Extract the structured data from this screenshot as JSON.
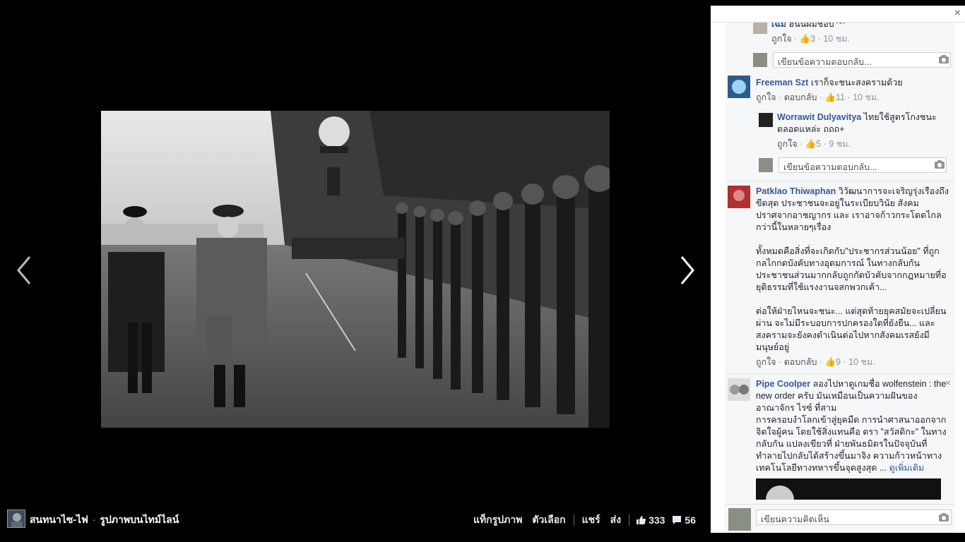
{
  "viewer": {
    "prev_label": "previous-photo",
    "next_label": "next-photo"
  },
  "bottom_bar": {
    "owner": "สนทนาไซ-ไฟ",
    "separator": "·",
    "album": "รูปภาพบนไทม์ไลน์",
    "tag_photo": "แท็กรูปภาพ",
    "options": "ตัวเลือก",
    "share": "แชร์",
    "send": "ส่ง",
    "likes": "333",
    "comments": "56"
  },
  "panel": {
    "close": "×",
    "comments": [
      {
        "type": "reply",
        "name": "เฉิม",
        "text": " ฮันนีผมชอบ ^^",
        "meta_like": "ถูกใจ",
        "meta_count": "3",
        "meta_time": "10 ชม."
      },
      {
        "type": "replybox",
        "placeholder": "เขียนข้อความตอบกลับ..."
      },
      {
        "type": "comment",
        "name": "Freeman Szt",
        "text": " เราก็จะชนะสงครามด้วย",
        "meta_like": "ถูกใจ",
        "meta_reply": "ตอบกลับ",
        "meta_count": "11",
        "meta_time": "10 ชม."
      },
      {
        "type": "reply",
        "name": "Worrawit Dulyavitya",
        "text": " ไทยใช้สูตรโกงชนะตลอดแหล่ะ ถถถ+",
        "meta_like": "ถูกใจ",
        "meta_count": "5",
        "meta_time": "9 ชม."
      },
      {
        "type": "replybox",
        "placeholder": "เขียนข้อความตอบกลับ..."
      },
      {
        "type": "comment",
        "name": "Patklao Thiwaphan",
        "text": " วิวัฒนาการจะเจริญรุ่งเรืองถึงขีดสุด ประชาชนจะอยู่ในระเบียบวินัย สังคมปราศจากอาชญากร และ เราอาจก้าวกระโดดไกลกว่านี้ในหลายๆเรื่อง",
        "text2": "ทั้งหมดคือสิ่งที่จะเกิดกับ\"ประชากรส่วนน้อย\" ที่ถูกกลไกกดบังคับทางอุดมการณ์ ในทางกลับกัน ประชาชนส่วนมากกลับถูกกัดบัวคับจากกฎหมายที่อยุติธรรมที่ใช้แรงงานจสกพวกเค้า...",
        "text3": "ต่อให้ฝ่ายไหนจะชนะ... แต่สุดท้ายยุคสมัยจะเปลี่ยนผ่าน จะไม่มีระบอบการปกครองใดที่ยังยืน... และ สงครามจะยังคงดำเนินต่อไปหากสังคมเรสยังมีมนุษย์อยู่",
        "meta_like": "ถูกใจ",
        "meta_reply": "ตอบกลับ",
        "meta_count": "9",
        "meta_time": "10 ชม."
      },
      {
        "type": "comment",
        "name": "Pipe Coolper",
        "text": " ลองไปหาดูเกมชื่อ wolfenstein : the new order ครับ มันเหมือนเป็นความฝันของ อาณาจักร ไรซ์ ที่สาม",
        "text2": "การครอบงำโลกเข้าสู่ยุคมืด การนำศาสนาออกจากจิตใจผู้คน โดยใช้สิ่งแทนคือ ตรา \"สวัสดิกะ\" ในทางกลับกัน แปลงเขียวที่ ฝ่ายพันธมิตรในปัจจุบันที่ทำลายไปกลับได้สร้างขึ้นมาจิง ความก้าวหน้าทางเทคโนโลยีทางทหารขึ้นจุดสูงสุด ...",
        "see_more": "ดูเพิ่มเติม",
        "close": "×"
      }
    ],
    "composer_placeholder": "เขียนความคิดเห็น"
  }
}
